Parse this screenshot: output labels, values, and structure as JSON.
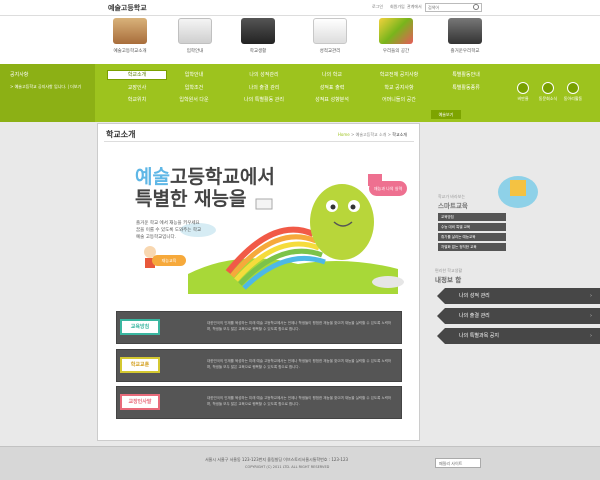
{
  "header": {
    "site_title": "예술고등학교",
    "util_links": [
      "로그인",
      "회원가입",
      "관계에서"
    ],
    "search_placeholder": "검색어"
  },
  "nav": {
    "categories": [
      {
        "label": "예술고등학교소개",
        "icon": "school-building-icon"
      },
      {
        "label": "입학안내",
        "icon": "document-icon"
      },
      {
        "label": "학교생활",
        "icon": "book-icon"
      },
      {
        "label": "성적교관리",
        "icon": "report-icon"
      },
      {
        "label": "우리들의 공간",
        "icon": "sticky-notes-icon"
      },
      {
        "label": "즐거운우리학교",
        "icon": "classroom-desk-icon"
      }
    ],
    "notice": {
      "title": "공지사항",
      "text": "> 예술고등학교 공지사항 입니다. | 더보기"
    },
    "sub_rows": [
      [
        "학교소개",
        "입학안내",
        "나의 성적관리",
        "나의 학교",
        "학교전체 공지사항",
        "특별활동안내"
      ],
      [
        "교장인사",
        "입학조건",
        "나의 출결 관리",
        "성적표 출력",
        "학교 공지사항",
        "특별활동종류"
      ],
      [
        "학교위치",
        "입학원서 다운",
        "나의 특별활동 관리",
        "성적표 성향분석",
        "어머니들의 공간",
        ""
      ]
    ],
    "quick_links": [
      "비만율",
      "동문회소식",
      "동아리활동"
    ],
    "more_button": "예술보기"
  },
  "main": {
    "page_title": "학교소개",
    "breadcrumb": [
      "Home",
      "예술고등학교 소개",
      "학교소개"
    ],
    "hero": {
      "highlight": "예술",
      "line1_rest": "고등학교에서",
      "line2": "특별한 재능을",
      "desc": [
        "즐거운 학교 에서 재능을 키우세요",
        "꿈을 이룰 수 있도록 도와주는 학교",
        "예술 고등학교입니다."
      ],
      "button": "재능교육",
      "bubble": "재능과 나의 실력"
    },
    "principles": [
      {
        "label": "교육방침",
        "color": "#3ab6a0",
        "text": "대한민국의 인재를 육성하는 미래 예술 고등학교에서는 언제나 학생들이 평범한 재능을 찾으며 재능을 실력할 수 있도록 노력하며, 학생들 모두 많은 교육으로 행복할 수 있도록 함으로 합니다."
      },
      {
        "label": "학교교훈",
        "color": "#d4c830",
        "text": "대한민국의 인재를 육성하는 미래 예술 고등학교에서는 언제나 학생들이 평범한 재능을 찾으며 재능을 실력할 수 있도록 노력하며, 학생들 모두 많은 교육으로 행복할 수 있도록 함으로 합니다."
      },
      {
        "label": "교장인사말",
        "color": "#e86a7a",
        "text": "대한민국의 인재를 육성하는 미래 예술 고등학교에서는 언제나 학생들이 평범한 재능을 찾으며 재능을 실력할 수 있도록 노력하며, 학생들 모두 많은 교육으로 행복할 수 있도록 함으로 합니다."
      }
    ]
  },
  "side": {
    "smart_subtitle": "학교가 바라보는",
    "smart_title": "스마트교육",
    "smart_items": [
      "교육방침",
      "수능 대비 특별 교육",
      "휴가를 살리는 예능교육",
      "차별화 없는 정직한 교육"
    ],
    "info_subtitle": "편리한 학교생활",
    "info_title": "내정보 함",
    "info_buttons": [
      "나의 성적 관리",
      "나의 출결 관리",
      "나의 특별과목 공지"
    ]
  },
  "footer": {
    "address": "서울시 서울구 서울동 123-123번지 올림빌딩 이브스토리서울시통학번호 : 123-123",
    "copyright": "COPYRIGHT (C) 2011 LTD. ALL RIGHT RESERVED",
    "family_site": "패밀리 사이트"
  }
}
